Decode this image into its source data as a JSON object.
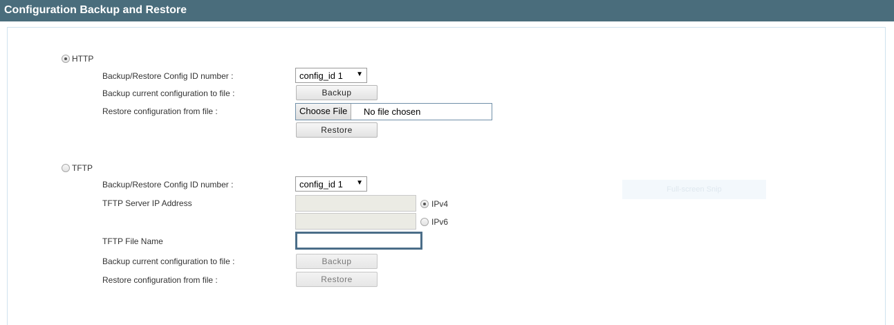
{
  "header": {
    "title": "Configuration Backup and Restore"
  },
  "http": {
    "label": "HTTP",
    "selected": true,
    "config_id_label": "Backup/Restore Config ID number :",
    "config_id_value": "config_id 1",
    "backup_label": "Backup current configuration to file :",
    "backup_button": "Backup",
    "restore_label": "Restore configuration from file :",
    "choose_file_button": "Choose File",
    "file_status": "No file chosen",
    "restore_button": "Restore"
  },
  "tftp": {
    "label": "TFTP",
    "selected": false,
    "config_id_label": "Backup/Restore Config ID number :",
    "config_id_value": "config_id 1",
    "server_ip_label": "TFTP Server IP Address",
    "ipv4_label": "IPv4",
    "ipv6_label": "IPv6",
    "ip_version_selected": "IPv4",
    "ipv4_value": "",
    "ipv6_value": "",
    "file_name_label": "TFTP File Name",
    "file_name_value": "",
    "backup_label": "Backup current configuration to file :",
    "backup_button": "Backup",
    "restore_label": "Restore configuration from file :",
    "restore_button": "Restore"
  },
  "overlay": {
    "snip_label": "Full-screen Snip"
  },
  "colors": {
    "header_bg": "#4a6d7c",
    "header_text": "#ffffff",
    "panel_border": "#cfe2ee",
    "focus_border": "#4a6d88"
  }
}
